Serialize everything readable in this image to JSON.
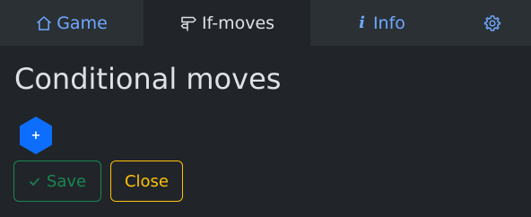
{
  "tabs": {
    "game": {
      "label": "Game",
      "icon": "home-icon"
    },
    "ifmoves": {
      "label": "If-moves",
      "icon": "signpost-icon",
      "active": true
    },
    "info": {
      "label": "Info",
      "glyph": "i",
      "icon": "info-icon"
    },
    "settings": {
      "icon": "gear-icon"
    }
  },
  "main": {
    "title": "Conditional moves",
    "add_glyph": "+",
    "save_label": "Save",
    "close_label": "Close"
  },
  "colors": {
    "background": "#212529",
    "tabbar": "#2b3035",
    "link": "#6ea8fe",
    "hex_blue": "#0d6efd",
    "success": "#198754",
    "warning": "#ffc107"
  }
}
